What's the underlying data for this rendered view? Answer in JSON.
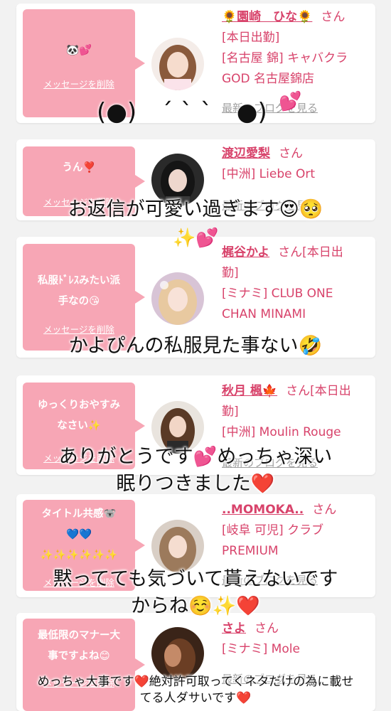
{
  "delete_label": "メッセージを削除",
  "blog_label": "最新のブログを見る",
  "san": "さん",
  "cards": [
    {
      "message": "🐼💕",
      "name": "🌻園崎　ひな🌻",
      "lines": [
        "[本日出勤]",
        "[名古屋 錦] キャバクラ",
        "GOD 名古屋錦店"
      ]
    },
    {
      "message": "うん❣️",
      "name": "渡辺愛梨",
      "lines": [
        "[中洲] Liebe Ort"
      ]
    },
    {
      "message": "私服ﾄﾞﾚｽみたい派\n手なの😘",
      "name": "梶谷かよ",
      "name_suffix": "[本日出",
      "lines": [
        "勤]",
        "[ミナミ] CLUB ONE",
        "CHAN MINAMI"
      ]
    },
    {
      "message": "ゆっくりおやすみ\nなさい✨",
      "name": "秋月 楓🍁",
      "name_suffix": "[本日出",
      "lines": [
        "勤]",
        "[中洲] Moulin Rouge"
      ]
    },
    {
      "message": "タイトル共感🐨\n💙💙\n✨✨✨✨✨✨",
      "name": "..MOMOKA..",
      "lines": [
        "[岐阜 可児] クラブ",
        "PREMIUM"
      ]
    },
    {
      "message": "最低限のマナー大\n事ですよね😊",
      "name": "さよ",
      "lines": [
        "[ミナミ] Mole"
      ]
    }
  ],
  "overlays": {
    "face": "(●)　´ ` `　●)",
    "caption1": "お返信が可愛い過ぎます😍🥺",
    "deco1": "✨💕",
    "caption2": "かよぴんの私服見た事ない🤣",
    "caption3": "ありがとうです💕めっちゃ深い\n眠りつきました❤️",
    "caption4": "黙ってても気づいて貰えないです\nからね☺️✨❤️",
    "caption5": "めっちゃ大事です❤️絶対許可取ってくネタだけの為に載せ\nてる人ダサいです❤️",
    "deco_hearts": "💕"
  },
  "colors": {
    "accent": "#d8436b",
    "bubble": "#f7a6b5",
    "background": "#f2f2f2"
  }
}
